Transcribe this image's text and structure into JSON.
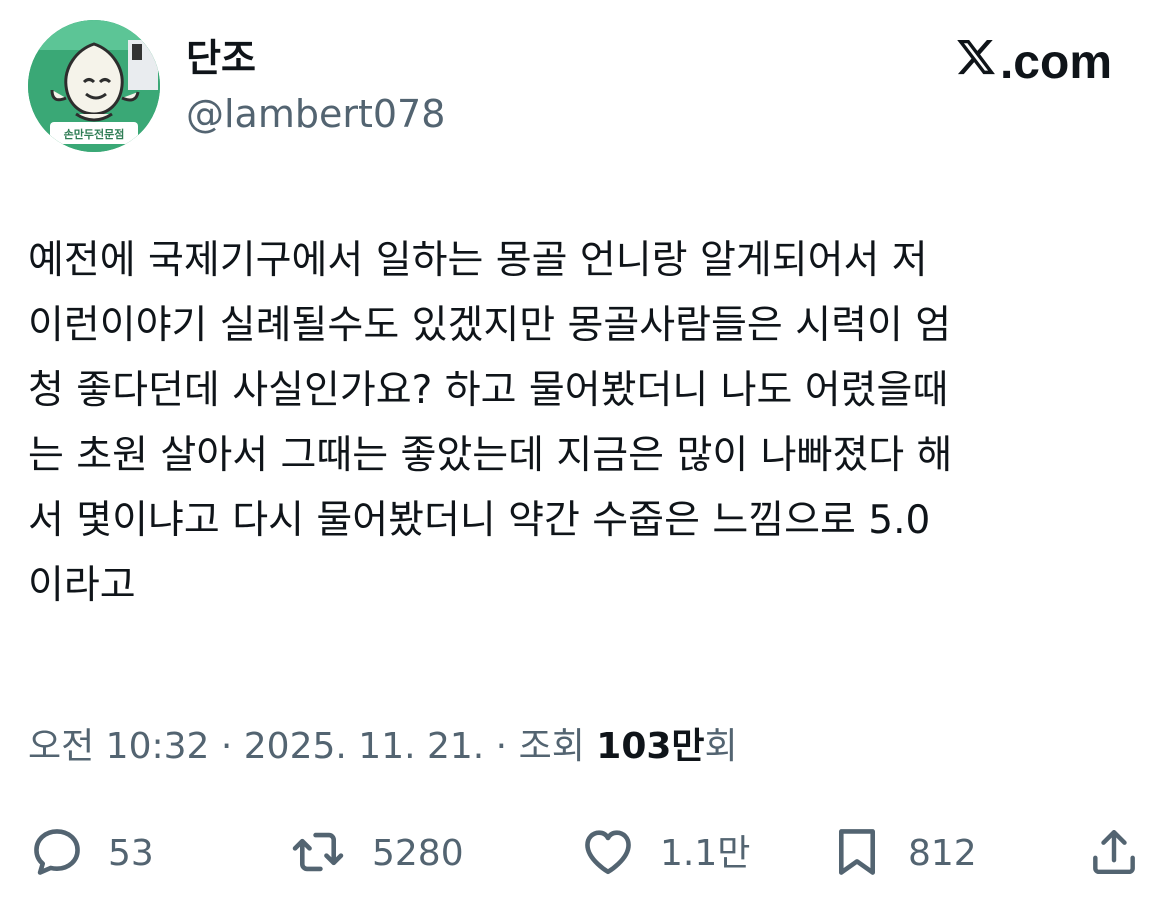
{
  "author": {
    "display_name": "단조",
    "handle": "@lambert078",
    "avatar_icon": "dumpling-mascot-avatar",
    "avatar_sign_text": "손만두전문점"
  },
  "brand": {
    "logo_icon": "x-logo-icon",
    "domain_label": ".com"
  },
  "tweet": {
    "lines": [
      "예전에 국제기구에서 일하는 몽골 언니랑 알게되어서 저",
      "이런이야기 실례될수도 있겠지만 몽골사람들은 시력이 엄",
      "청 좋다던데 사실인가요? 하고 물어봤더니 나도 어렸을때",
      "는 초원 살아서 그때는 좋았는데 지금은 많이 나빠졌다 해",
      "서 몇이냐고 다시 물어봤더니 약간 수줍은 느낌으로 5.0",
      "이라고"
    ]
  },
  "meta": {
    "time": "오전 10:32",
    "separator": " · ",
    "date": "2025. 11. 21.",
    "views_label": "조회 ",
    "views_count": "103만",
    "views_suffix": "회"
  },
  "actions": {
    "reply_count": "53",
    "retweet_count": "5280",
    "like_count": "1.1만",
    "bookmark_count": "812"
  },
  "colors": {
    "text_primary": "#0f1419",
    "text_secondary": "#536471",
    "avatar_bg": "#3aa876"
  }
}
